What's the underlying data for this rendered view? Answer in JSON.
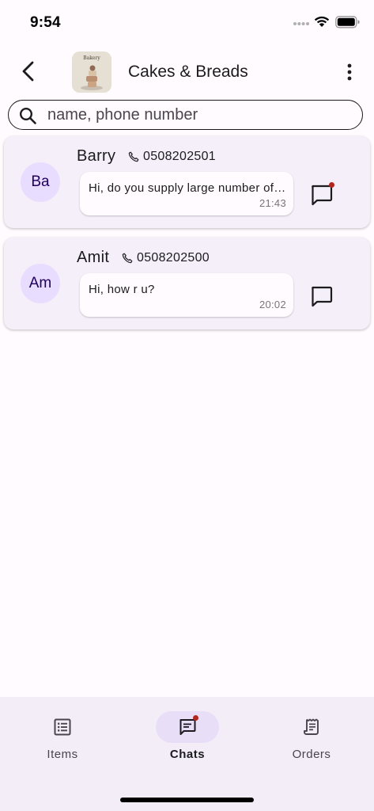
{
  "status_bar": {
    "time": "9:54",
    "icons": [
      "cellular-dots-icon",
      "wifi-icon",
      "battery-icon"
    ]
  },
  "app_bar": {
    "title": "Cakes & Breads",
    "logo_text": "Bakery",
    "icons": [
      "back-arrow-icon",
      "more-vertical-icon"
    ]
  },
  "search": {
    "placeholder": "name, phone number",
    "value": "",
    "icon": "search-icon"
  },
  "chats": [
    {
      "initials": "Ba",
      "name": "Barry",
      "phone": "0508202501",
      "last_message": "Hi, do you supply large number of cakes for events?",
      "time": "21:43",
      "unread": true
    },
    {
      "initials": "Am",
      "name": "Amit",
      "phone": "0508202500",
      "last_message": "Hi, how r u?",
      "time": "20:02",
      "unread": false
    }
  ],
  "bottom_nav": {
    "items": [
      {
        "label": "Items",
        "icon": "list-icon",
        "active": false
      },
      {
        "label": "Chats",
        "icon": "chat-icon",
        "active": true,
        "badge": true
      },
      {
        "label": "Orders",
        "icon": "receipt-icon",
        "active": false
      }
    ]
  },
  "colors": {
    "background": "#fffbfe",
    "card": "#f4eff8",
    "avatar": "#e9ddff",
    "nav_background": "#f3edf7",
    "nav_active_indicator": "#e8def8",
    "badge": "#b3261e"
  }
}
